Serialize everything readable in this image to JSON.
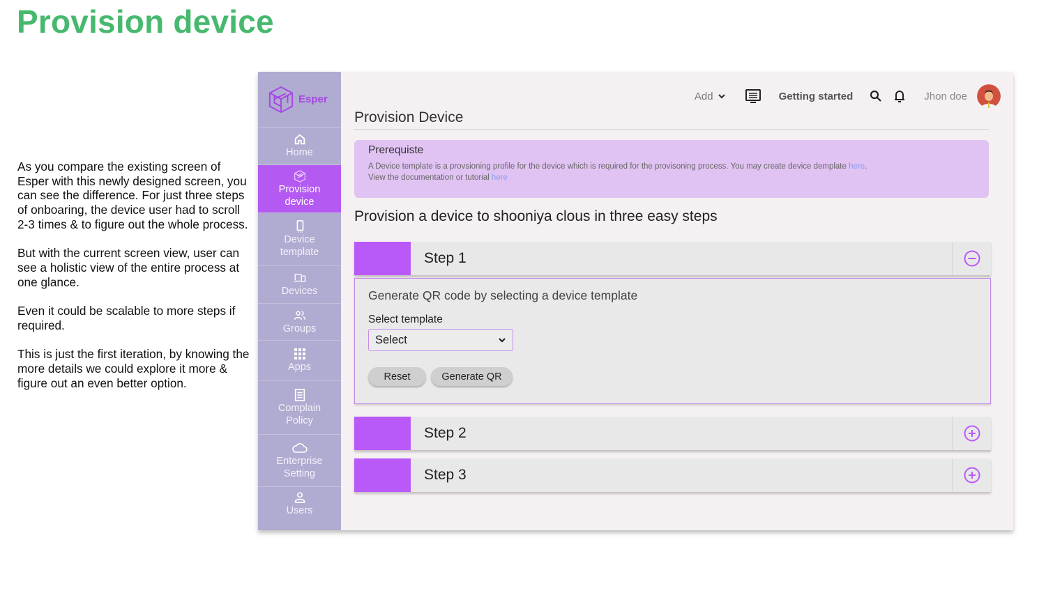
{
  "slide": {
    "title": "Provision device",
    "notes": [
      "As you compare the existing screen of Esper with this newly designed screen, you can see the difference. For just three steps of onboaring, the device user had to scroll 2-3 times & to figure out the whole process.",
      "But with the current screen view, user can see a holistic view of the entire process at one glance.",
      "Even it could be scalable to more steps if required.",
      "This is just the first iteration, by knowing the more details we could explore it more & figure out an even better option."
    ]
  },
  "app": {
    "brand": "Esper",
    "colors": {
      "accent": "#b95af8",
      "sidebar": "#b0abd0",
      "prereq_bg": "#e0c3f2",
      "slide_title": "#47b96e"
    },
    "sidebar": {
      "items": [
        {
          "label": "Home",
          "icon": "home-icon"
        },
        {
          "label": "Provision device",
          "icon": "provision-icon",
          "active": true
        },
        {
          "label": "Device template",
          "icon": "phone-icon"
        },
        {
          "label": "Devices",
          "icon": "devices-icon"
        },
        {
          "label": "Groups",
          "icon": "groups-icon"
        },
        {
          "label": "Apps",
          "icon": "apps-grid-icon"
        },
        {
          "label": "Complain Policy",
          "icon": "document-icon"
        },
        {
          "label": "Enterprise Setting",
          "icon": "cloud-icon"
        },
        {
          "label": "Users",
          "icon": "user-icon"
        }
      ]
    },
    "topbar": {
      "add_label": "Add",
      "getting_started": "Getting started",
      "user_name": "Jhon doe"
    },
    "page": {
      "title": "Provision Device",
      "prerequisite": {
        "title": "Prerequiste",
        "line1": "A Device template is a provsioning profile for the device which is required for the provisoning process. You may create device demplate ",
        "line1_link": "here",
        "line1_end": ".",
        "line2": "View the documentation or tutorial ",
        "line2_link": "here"
      },
      "subtitle": "Provision a device to shooniya clous in three easy steps",
      "steps": [
        {
          "label": "Step 1",
          "expanded": true,
          "heading": "Generate QR code by selecting a device template",
          "field_label": "Select template",
          "select_value": "Select",
          "reset_label": "Reset",
          "generate_label": "Generate QR"
        },
        {
          "label": "Step 2",
          "expanded": false
        },
        {
          "label": "Step 3",
          "expanded": false
        }
      ]
    }
  }
}
